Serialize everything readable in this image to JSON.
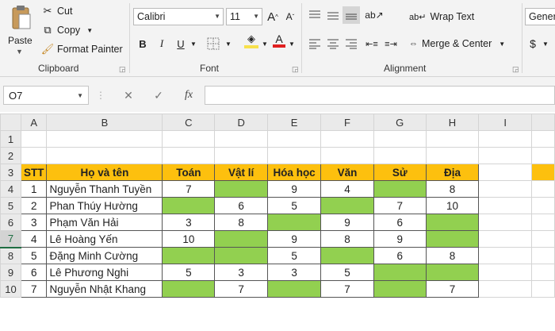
{
  "clipboard": {
    "paste_label": "Paste",
    "cut_label": "Cut",
    "copy_label": "Copy",
    "format_painter_label": "Format Painter",
    "group_label": "Clipboard"
  },
  "font": {
    "font_name": "Calibri",
    "font_size": "11",
    "bold": "B",
    "italic": "I",
    "underline": "U",
    "grow": "A",
    "shrink": "A",
    "font_color_glyph": "A",
    "group_label": "Font",
    "fill_color": "#f8e14c",
    "font_color": "#e02020"
  },
  "alignment": {
    "wrap_text_label": "Wrap Text",
    "merge_center_label": "Merge & Center",
    "group_label": "Alignment"
  },
  "number": {
    "format_label": "Genera",
    "currency_glyph": "$"
  },
  "formula_bar": {
    "name_box": "O7",
    "fx": "fx",
    "formula": ""
  },
  "sheet": {
    "columns": [
      "A",
      "B",
      "C",
      "D",
      "E",
      "F",
      "G",
      "H",
      "I"
    ],
    "row_numbers": [
      "1",
      "2",
      "3",
      "4",
      "5",
      "6",
      "7",
      "8",
      "9",
      "10"
    ],
    "header": [
      "STT",
      "Họ và tên",
      "Toán",
      "Vật lí",
      "Hóa học",
      "Văn",
      "Sử",
      "Địa"
    ],
    "rows": [
      [
        "1",
        "Nguyễn Thanh Tuyền",
        "7",
        "",
        "9",
        "4",
        "",
        "8"
      ],
      [
        "2",
        "Phan Thúy Hường",
        "",
        "6",
        "5",
        "",
        "7",
        "10"
      ],
      [
        "3",
        "Phạm Văn Hải",
        "3",
        "8",
        "",
        "9",
        "6",
        ""
      ],
      [
        "4",
        "Lê Hoàng Yến",
        "10",
        "",
        "9",
        "8",
        "9",
        ""
      ],
      [
        "5",
        "Đặng Minh Cường",
        "",
        "",
        "5",
        "",
        "6",
        "8"
      ],
      [
        "6",
        "Lê Phương Nghi",
        "5",
        "3",
        "3",
        "5",
        "",
        ""
      ],
      [
        "7",
        "Nguyễn Nhật Khang",
        "",
        "7",
        "",
        "7",
        "",
        "7"
      ]
    ],
    "green_color": "#92d050",
    "header_color": "#fdc00e"
  }
}
